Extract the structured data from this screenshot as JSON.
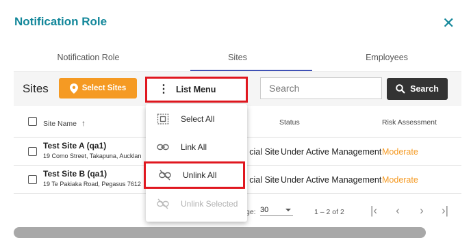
{
  "dialog": {
    "title": "Notification Role",
    "close_icon": "close-icon"
  },
  "tabs": [
    {
      "label": "Notification Role",
      "active": false
    },
    {
      "label": "Sites",
      "active": true
    },
    {
      "label": "Employees",
      "active": false
    }
  ],
  "toolbar": {
    "sites_label": "Sites",
    "select_sites_label": "Select Sites",
    "list_menu_label": "List Menu",
    "search_placeholder": "Search",
    "search_button_label": "Search"
  },
  "table": {
    "headers": {
      "site_name": "Site Name",
      "status": "Status",
      "risk": "Risk Assessment"
    },
    "rows": [
      {
        "name": "Test Site A (qa1)",
        "address": "19 Como Street, Takapuna, Aucklan",
        "type": "cial Site",
        "status": "Under Active Management",
        "risk": "Moderate"
      },
      {
        "name": "Test Site B (qa1)",
        "address": "19 Te Pakiaka Road, Pegasus 7612",
        "type": "cial Site",
        "status": "Under Active Management",
        "risk": "Moderate"
      }
    ]
  },
  "pager": {
    "label": "ge:",
    "page_size": "30",
    "range": "1 – 2 of 2"
  },
  "menu": {
    "items": [
      {
        "label": "Select All",
        "icon": "select-all-icon",
        "disabled": false
      },
      {
        "label": "Link All",
        "icon": "link-icon",
        "disabled": false
      },
      {
        "label": "Unlink All",
        "icon": "link-off-icon",
        "disabled": false
      },
      {
        "label": "Unlink Selected",
        "icon": "link-off-icon",
        "disabled": true
      }
    ]
  },
  "colors": {
    "title": "#13879a",
    "accent": "#f59a23",
    "highlight": "#e0171f",
    "tab_indicator": "#3f51b5"
  }
}
